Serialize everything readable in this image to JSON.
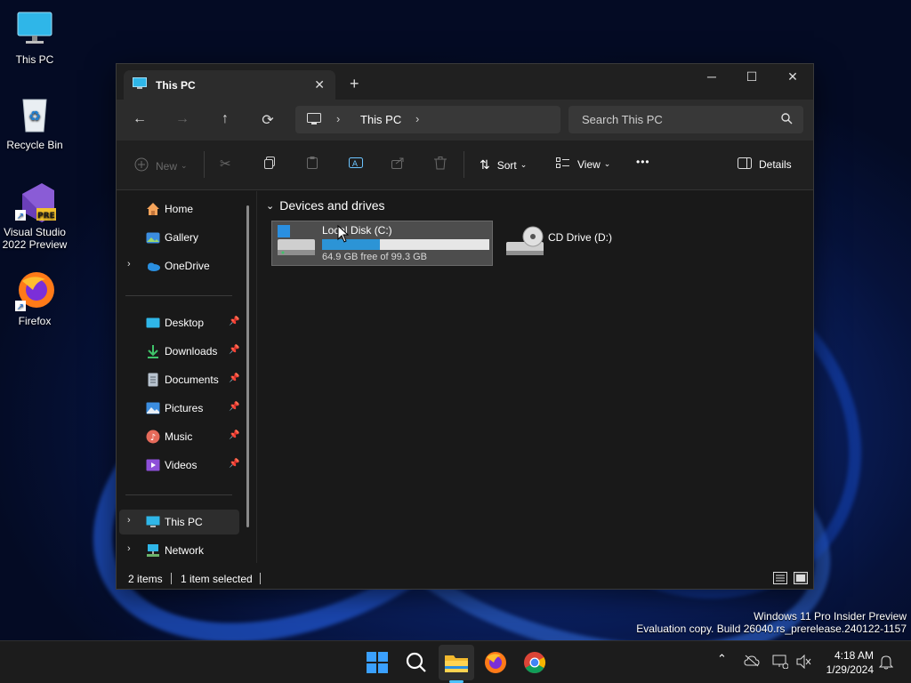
{
  "desktop": {
    "icons": [
      {
        "label": "This PC"
      },
      {
        "label": "Recycle Bin"
      },
      {
        "label": "Visual Studio 2022 Preview",
        "badge": "PRE"
      },
      {
        "label": "Firefox"
      }
    ]
  },
  "window": {
    "tab_title": "This PC",
    "tab_close": "✕",
    "new_tab": "+",
    "minimize": "─",
    "maximize": "☐",
    "close": "✕"
  },
  "navbar": {
    "back": "←",
    "forward": "→",
    "up": "↑",
    "refresh": "⟳",
    "breadcrumb": "This PC",
    "search_placeholder": "Search This PC"
  },
  "commandbar": {
    "new_label": "New",
    "sort_label": "Sort",
    "view_label": "View",
    "more": "•••",
    "details_label": "Details"
  },
  "sidebar": {
    "home": "Home",
    "gallery": "Gallery",
    "onedrive": "OneDrive",
    "desktop": "Desktop",
    "downloads": "Downloads",
    "documents": "Documents",
    "pictures": "Pictures",
    "music": "Music",
    "videos": "Videos",
    "thispc": "This PC",
    "network": "Network",
    "pin": "📌"
  },
  "content": {
    "group_title": "Devices and drives",
    "drives": [
      {
        "name": "Local Disk (C:)",
        "free_text": "64.9 GB free of 99.3 GB",
        "used_fraction": 0.346
      },
      {
        "name": "CD Drive (D:)"
      }
    ]
  },
  "status": {
    "items": "2 items",
    "selected": "1 item selected"
  },
  "watermark": {
    "line1": "Windows 11 Pro Insider Preview",
    "line2": "Evaluation copy. Build 26040.rs_prerelease.240122-1157"
  },
  "taskbar": {
    "time": "4:18 AM",
    "date": "1/29/2024"
  },
  "colors": {
    "accent": "#4cc2ff",
    "drive_fill": "#2c94d6"
  }
}
